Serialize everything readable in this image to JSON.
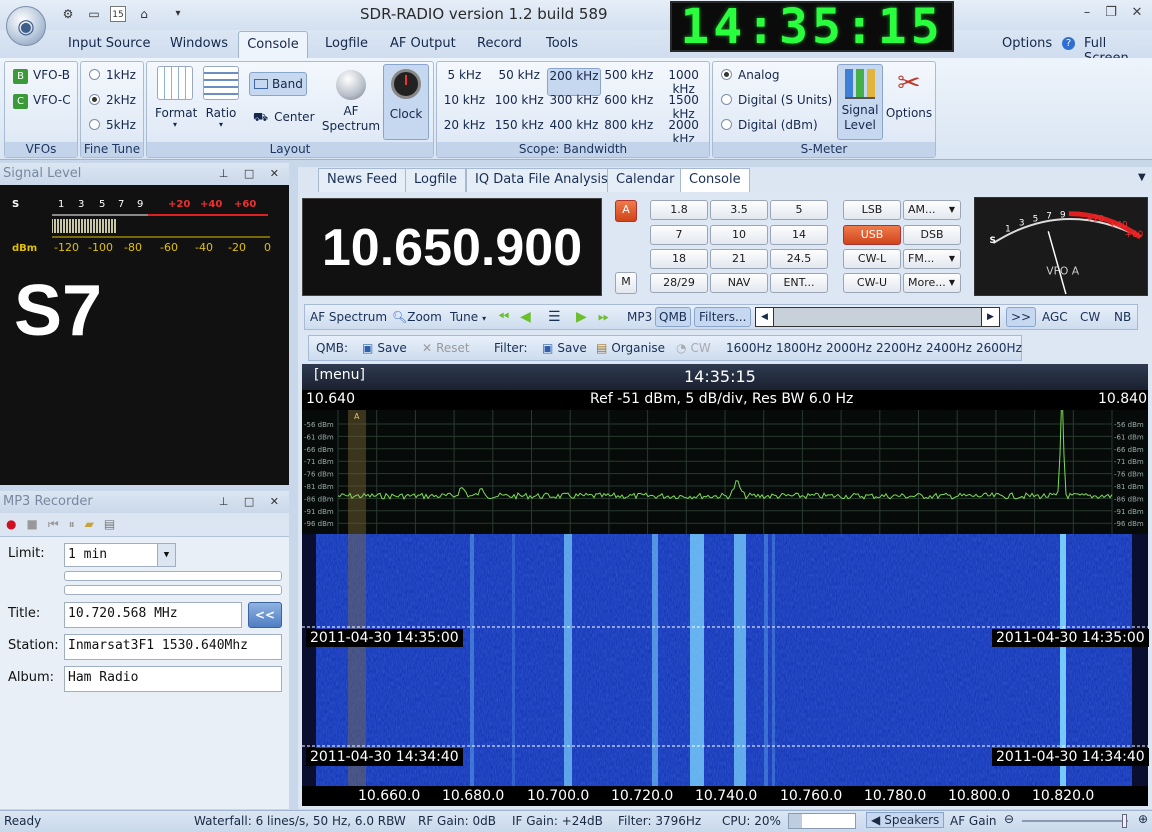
{
  "window": {
    "title": "SDR-RADIO version 1.2  build 589",
    "clock": "14:35:15",
    "options_label": "Options",
    "fullscreen_label": "Full Screen"
  },
  "menu": [
    {
      "label": "Input Source"
    },
    {
      "label": "Windows"
    },
    {
      "label": "Console"
    },
    {
      "label": "Logfile"
    },
    {
      "label": "AF Output"
    },
    {
      "label": "Record"
    },
    {
      "label": "Tools"
    }
  ],
  "ribbon": {
    "vfos": {
      "label": "VFOs",
      "items": [
        "VFO-B",
        "VFO-C"
      ],
      "icons": [
        "B",
        "C"
      ]
    },
    "fine_tune": {
      "label": "Fine Tune",
      "options": [
        "1kHz",
        "2kHz",
        "5kHz"
      ],
      "selected": "2kHz"
    },
    "layout": {
      "label": "Layout",
      "format": "Format",
      "ratio": "Ratio",
      "band": "Band",
      "center": "Center",
      "af_spectrum": "AF Spectrum",
      "clock": "Clock"
    },
    "bandwidth": {
      "label": "Scope: Bandwidth",
      "rows": [
        [
          "5 kHz",
          "50 kHz",
          "200 kHz",
          "500 kHz",
          "1000 kHz"
        ],
        [
          "10 kHz",
          "100 kHz",
          "300 kHz",
          "600 kHz",
          "1500 kHz"
        ],
        [
          "20 kHz",
          "150 kHz",
          "400 kHz",
          "800 kHz",
          "2000 kHz"
        ]
      ],
      "selected": "200 kHz"
    },
    "smeter": {
      "label": "S-Meter",
      "options": [
        "Analog",
        "Digital (S Units)",
        "Digital (dBm)"
      ],
      "selected": "Analog",
      "signal_level": "Signal Level",
      "options_btn": "Options"
    }
  },
  "signal_panel": {
    "title": "Signal Level",
    "s_scale": [
      "S",
      "1",
      "3",
      "5",
      "7",
      "9",
      "+20",
      "+40",
      "+60"
    ],
    "dbm_scale": [
      "dBm",
      "-120",
      "-100",
      "-80",
      "-60",
      "-40",
      "-20",
      "0"
    ],
    "reading": "S7"
  },
  "mp3_panel": {
    "title": "MP3 Recorder",
    "limit_label": "Limit:",
    "limit_value": "1 min",
    "title_label": "Title:",
    "title_value": "10.720.568 MHz",
    "back_button": "<<",
    "station_label": "Station:",
    "station_value": "Inmarsat3F1 1530.640Mhz",
    "album_label": "Album:",
    "album_value": "Ham Radio"
  },
  "tabs": [
    {
      "label": "News Feed"
    },
    {
      "label": "Logfile"
    },
    {
      "label": "IQ Data File Analysis"
    },
    {
      "label": "Calendar"
    },
    {
      "label": "Console"
    }
  ],
  "console": {
    "frequency": "10.650.900",
    "a_button": "A",
    "m_button": "M",
    "bands": [
      [
        "1.8",
        "3.5",
        "5"
      ],
      [
        "7",
        "10",
        "14"
      ],
      [
        "18",
        "21",
        "24.5"
      ],
      [
        "28/29",
        "NAV",
        "ENT..."
      ]
    ],
    "modes": [
      [
        "LSB",
        "AM..."
      ],
      [
        "USB",
        "DSB"
      ],
      [
        "CW-L",
        "FM..."
      ],
      [
        "CW-U",
        "More..."
      ]
    ],
    "selected_mode": "USB",
    "meter_scale": [
      "S",
      "1",
      "3",
      "5",
      "7",
      "9",
      "+20",
      "+40",
      "+60"
    ],
    "vfo_label": "VFO A"
  },
  "toolbar1": {
    "items": [
      "AF Spectrum",
      "Zoom",
      "Tune",
      "MP3",
      "QMB",
      "Filters...",
      ">>",
      "AGC",
      "CW",
      "NB"
    ]
  },
  "toolbar2": {
    "qmb": "QMB:",
    "save": "Save",
    "reset": "Reset",
    "filter": "Filter:",
    "save2": "Save",
    "organise": "Organise",
    "cw": "CW",
    "widths": [
      "1600Hz",
      "1800Hz",
      "2000Hz",
      "2200Hz",
      "2400Hz",
      "2600Hz"
    ]
  },
  "spectrum": {
    "menu": "[menu]",
    "time": "14:35:15",
    "left_freq": "10.640",
    "right_freq": "10.840",
    "ref": "Ref -51 dBm,  5 dB/div,  Res BW 6.0 Hz",
    "db_labels": [
      "-56 dBm",
      "-61 dBm",
      "-66 dBm",
      "-71 dBm",
      "-76 dBm",
      "-81 dBm",
      "-86 dBm",
      "-91 dBm",
      "-96 dBm"
    ],
    "timestamps": [
      "2011-04-30  14:35:00",
      "2011-04-30  14:34:40"
    ],
    "axis": [
      "10.660.0",
      "10.680.0",
      "10.700.0",
      "10.720.0",
      "10.740.0",
      "10.760.0",
      "10.780.0",
      "10.800.0",
      "10.820.0"
    ]
  },
  "status": {
    "ready": "Ready",
    "waterfall": "Waterfall: 6 lines/s, 50 Hz, 6.0 RBW",
    "rf_gain": "RF Gain: 0dB",
    "if_gain": "IF Gain: +24dB",
    "filter": "Filter: 3796Hz",
    "cpu": "CPU: 20%",
    "speakers": "Speakers",
    "af_gain": "AF Gain"
  }
}
